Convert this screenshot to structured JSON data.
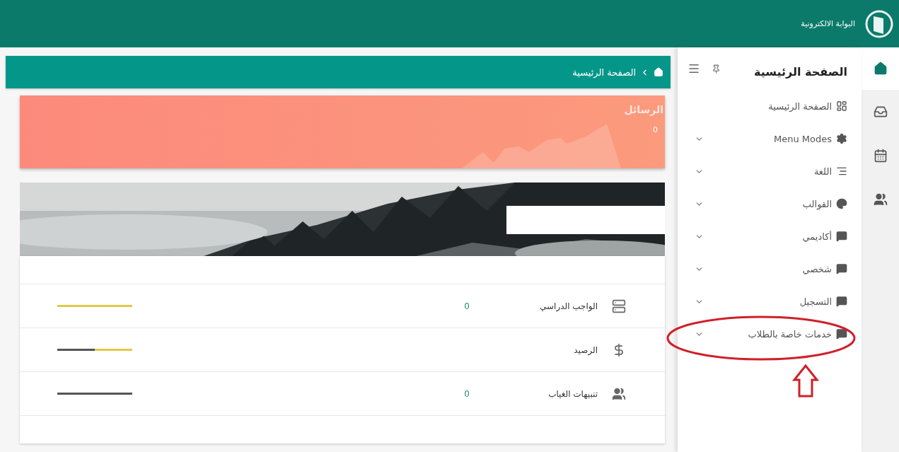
{
  "header": {
    "title": "البوابة الالكترونية"
  },
  "rail": [
    {
      "kind": "home",
      "selected": true
    },
    {
      "kind": "inbox",
      "selected": false
    },
    {
      "kind": "calendar",
      "selected": false
    },
    {
      "kind": "people",
      "selected": false
    }
  ],
  "sidebar": {
    "title": "الصفحة الرئيسية",
    "items": [
      {
        "label": "الصفحة الرئيسية",
        "kind": "dashboard",
        "expandable": false
      },
      {
        "label": "Menu Modes",
        "kind": "gear",
        "expandable": true
      },
      {
        "label": "اللغة",
        "kind": "lines",
        "expandable": true
      },
      {
        "label": "القوالب",
        "kind": "palette",
        "expandable": true
      },
      {
        "label": "أكاديمي",
        "kind": "message",
        "expandable": true
      },
      {
        "label": "شخصي",
        "kind": "message",
        "expandable": true
      },
      {
        "label": "التسجيل",
        "kind": "message",
        "expandable": true
      },
      {
        "label": "خدمات خاصة بالطلاب",
        "kind": "message",
        "expandable": true
      }
    ]
  },
  "breadcrumb": {
    "label": "الصفحة الرئيسية"
  },
  "messages_card": {
    "title": "الرسائل",
    "count": "0"
  },
  "stats": [
    {
      "label": "الواجب الدراسي",
      "kind": "server",
      "count": "0",
      "level": 0
    },
    {
      "label": "الرصيد",
      "kind": "dollar",
      "level": 0.5
    },
    {
      "label": "تنبيهات الغياب",
      "kind": "people",
      "count": "0",
      "level": 1
    }
  ]
}
